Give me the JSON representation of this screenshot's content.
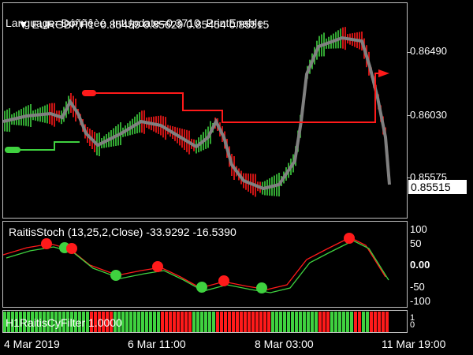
{
  "header": {
    "symbol": "EURGBP,H1",
    "ohlc": "0.85459 0.85629 0.85454 0.85515",
    "params": "Language=Đóññêèé  IntUpdate=0.3710  PrintEnable"
  },
  "price_axis": {
    "labels": [
      "0.86490",
      "0.86030",
      "0.85575"
    ],
    "current": "0.85515"
  },
  "oscillator": {
    "title": "RaitisStoch (13,25,2,Close) -33.9292 -16.5390",
    "labels": [
      "100",
      "50",
      "0.00",
      "-50",
      "-100"
    ]
  },
  "filter": {
    "title": "H1RaitisCyFilter 1.0000",
    "labels": [
      "1",
      "0"
    ]
  },
  "time_axis": {
    "labels": [
      "4 Mar 2019",
      "6 Mar 11:00",
      "8 Mar 03:00",
      "11 Mar 19:00"
    ]
  },
  "colors": {
    "green": "#3fd13f",
    "red": "#ff1a1a",
    "gray": "#808080",
    "background": "#000000",
    "grid": "#c0c0c0"
  }
}
